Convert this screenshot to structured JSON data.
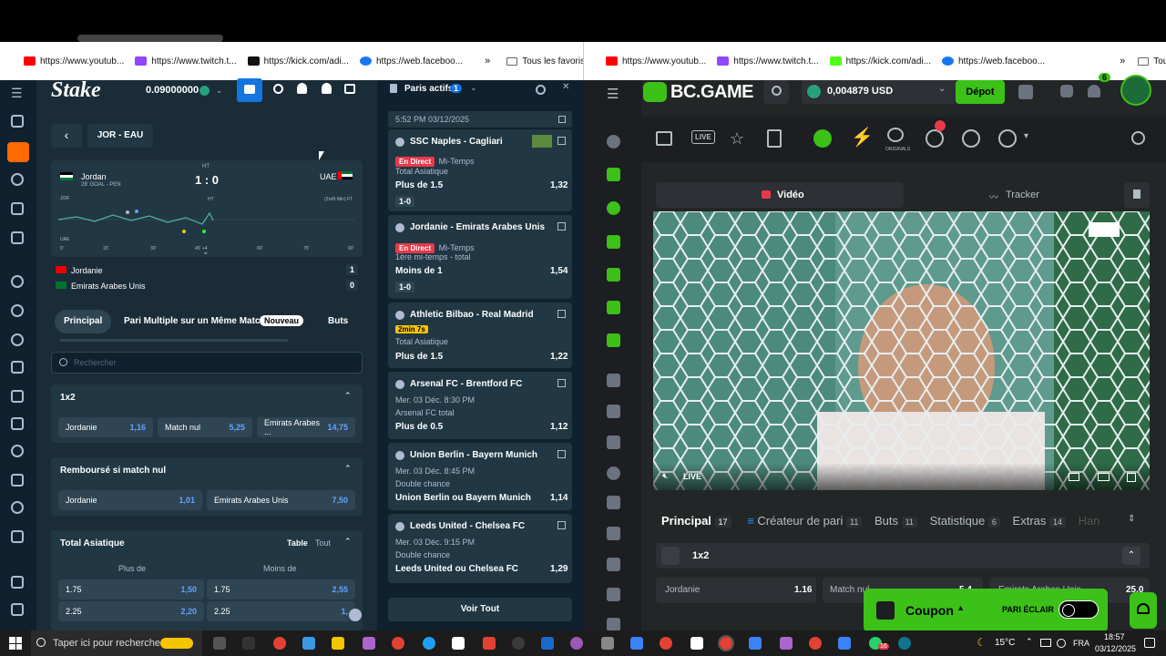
{
  "bookmarks_left": [
    "https://www.youtub...",
    "https://www.twitch.t...",
    "https://kick.com/adi...",
    "https://web.faceboo..."
  ],
  "bookmarks_right": [
    "https://www.youtub...",
    "https://www.twitch.t...",
    "https://kick.com/adi...",
    "https://web.faceboo..."
  ],
  "tous_favoris": "Tous les favoris",
  "stake": {
    "logo": "Stake",
    "balance": "0.09000000",
    "bets_panel_title": "Paris actifs",
    "bets_count": "1",
    "match_title": "JOR - EAU",
    "home_team": "Jordan",
    "home_info": "28' GOAL - PEN",
    "ht": "HT",
    "score": "1 : 0",
    "away_team": "UAE",
    "chart_home": "JOR",
    "chart_away": "UAE",
    "chart_ft": "(2x45 Min) FT",
    "chart_ticks": [
      "0'",
      "15'",
      "30'",
      "45' +4",
      "60'",
      "75'",
      "90'"
    ],
    "chart_ht": "HT",
    "team1": "Jordanie",
    "team1_score": "1",
    "team2": "Emirats Arabes Unis",
    "team2_score": "0",
    "tabs": [
      "Principal",
      "Pari Multiple sur un Même Match",
      "Nouveau",
      "Buts"
    ],
    "search_placeholder": "Rechercher",
    "m1x2": {
      "title": "1x2",
      "o1": "Jordanie",
      "v1": "1,16",
      "o2": "Match nul",
      "v2": "5,25",
      "o3": "Emirats Arabes ...",
      "v3": "14,75"
    },
    "rembourse": {
      "title": "Remboursé si match nul",
      "o1": "Jordanie",
      "v1": "1,01",
      "o2": "Emirats Arabes Unis",
      "v2": "7,50"
    },
    "asian": {
      "title": "Total Asiatique",
      "table": "Table",
      "tout": "Tout",
      "plus": "Plus de",
      "moins": "Moins de",
      "r1": [
        "1.75",
        "1,50",
        "1.75",
        "2,55"
      ],
      "r2": [
        "2.25",
        "2,20",
        "2.25",
        "1,"
      ]
    },
    "slip_time": "5:52 PM 03/12/2025",
    "bets": [
      {
        "match": "SSC Naples - Cagliari",
        "status": "En Direct",
        "phase": "Mi-Temps",
        "market": "Total Asiatique",
        "pick": "Plus de 1.5",
        "odds": "1,32",
        "score": "1-0"
      },
      {
        "match": "Jordanie - Emirats Arabes Unis",
        "status": "En Direct",
        "phase": "Mi-Temps",
        "market": "1ère mi-temps - total",
        "pick": "Moins de 1",
        "odds": "1,54",
        "score": "1-0"
      },
      {
        "match": "Athletic Bilbao - Real Madrid",
        "status": "2min 7s",
        "market": "Total Asiatique",
        "pick": "Plus de 1.5",
        "odds": "1,22"
      },
      {
        "match": "Arsenal FC - Brentford FC",
        "date": "Mer. 03 Déc. 8:30 PM",
        "market": "Arsenal FC total",
        "pick": "Plus de 0.5",
        "odds": "1,12"
      },
      {
        "match": "Union Berlin - Bayern Munich",
        "date": "Mer. 03 Déc. 8:45 PM",
        "market": "Double chance",
        "pick": "Union Berlin ou Bayern Munich",
        "odds": "1,14"
      },
      {
        "match": "Leeds United - Chelsea FC",
        "date": "Mer. 03 Déc. 9:15 PM",
        "market": "Double chance",
        "pick": "Leeds United ou Chelsea FC",
        "odds": "1,29"
      }
    ],
    "voir_tout": "Voir Tout"
  },
  "bc": {
    "logo": "BC.GAME",
    "balance": "0,004879 USD",
    "depot": "Dépot",
    "notif": "6",
    "originals": "ORIGINALS",
    "live_icon": "LIVE",
    "video_tab": "Vidéo",
    "tracker_tab": "Tracker",
    "live": "LIVE",
    "tabs": [
      {
        "l": "Principal",
        "c": "17"
      },
      {
        "l": "Créateur de pari",
        "c": "11"
      },
      {
        "l": "Buts",
        "c": "11"
      },
      {
        "l": "Statistique",
        "c": "6"
      },
      {
        "l": "Extras",
        "c": "14"
      },
      {
        "l": "Han",
        "c": ""
      }
    ],
    "m1x2": "1x2",
    "o1": "Jordanie",
    "v1": "1.16",
    "o2": "Match nul",
    "v2": "5.4",
    "o3": "Emirats Arabes Unis",
    "v3": "25.0",
    "coupon": "Coupon",
    "pari_eclair": "PARI ÉCLAIR"
  },
  "taskbar": {
    "search": "Taper ici pour rechercher",
    "temp": "15°C",
    "lang": "FRA",
    "time": "18:57",
    "date": "03/12/2025",
    "badge": "16"
  }
}
